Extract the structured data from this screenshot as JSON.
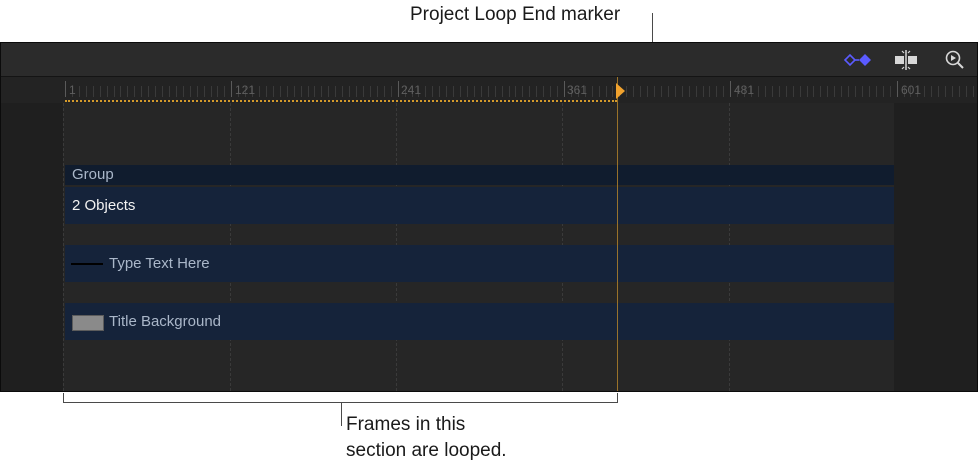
{
  "callouts": {
    "top": "Project Loop End marker",
    "bottom_line1": "Frames in this",
    "bottom_line2": "section are looped."
  },
  "toolbar": {
    "icons": [
      "keyframe-toggle-icon",
      "snapping-icon",
      "zoom-icon"
    ],
    "keyframe_color": "#5b5bff"
  },
  "ruler": {
    "labels": [
      "1",
      "121",
      "241",
      "361",
      "481",
      "601"
    ]
  },
  "tracks": {
    "group": {
      "label": "Group",
      "sublabel": "2 Objects"
    },
    "layers": [
      {
        "label": "Type Text Here"
      },
      {
        "label": "Title Background"
      }
    ]
  },
  "colors": {
    "panel_bg": "#262626",
    "bar_bg": "#15233a",
    "loop_marker": "#f0a22e"
  }
}
